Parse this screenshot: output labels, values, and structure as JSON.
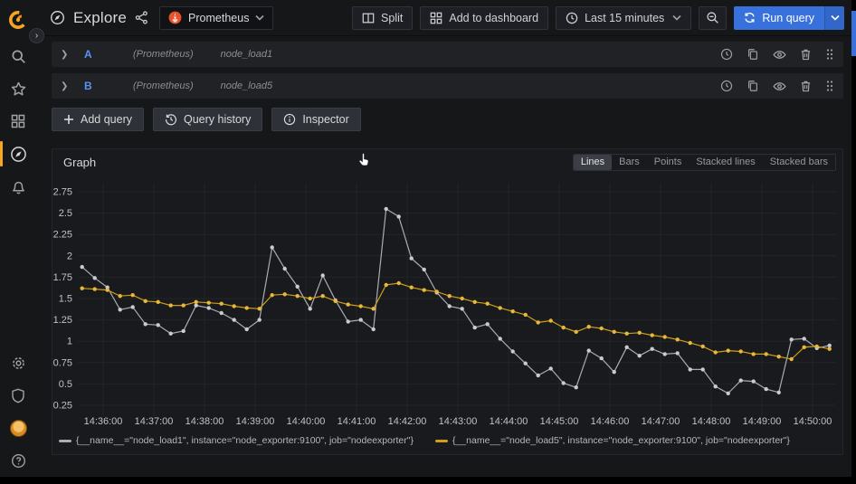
{
  "colors": {
    "accent_blue": "#3871dc",
    "grafana_orange": "#f5a623",
    "query_ref_blue": "#5794f2",
    "series_load1_line": "#a9acb2",
    "series_load1_point": "#c9cbcf",
    "series_load5_line": "#cf9f17",
    "series_load5_point": "#eab839",
    "grid": "#232428",
    "axis_text": "#c0c2c5"
  },
  "sidebar": {
    "icons": [
      {
        "name": "grafana-logo"
      },
      {
        "name": "search-icon"
      },
      {
        "name": "star-icon"
      },
      {
        "name": "dashboards-icon"
      },
      {
        "name": "explore-compass-icon",
        "active": true
      },
      {
        "name": "alerting-bell-icon"
      },
      {
        "name": "configuration-gear-icon"
      },
      {
        "name": "server-admin-shield-icon"
      },
      {
        "name": "user-avatar"
      },
      {
        "name": "help-icon"
      }
    ]
  },
  "topnav": {
    "title": "Explore",
    "datasource": {
      "name": "Prometheus"
    },
    "split_label": "Split",
    "add_to_dashboard_label": "Add to dashboard",
    "time_range_label": "Last 15 minutes",
    "run_query_label": "Run query"
  },
  "queries": {
    "rows": [
      {
        "ref": "A",
        "datasource": "(Prometheus)",
        "expr": "node_load1"
      },
      {
        "ref": "B",
        "datasource": "(Prometheus)",
        "expr": "node_load5"
      }
    ],
    "actions": {
      "add_query": "Add query",
      "query_history": "Query history",
      "inspector": "Inspector"
    }
  },
  "panel": {
    "title": "Graph",
    "modes": [
      "Lines",
      "Bars",
      "Points",
      "Stacked lines",
      "Stacked bars"
    ],
    "active_mode": "Lines"
  },
  "chart_data": {
    "type": "line",
    "title": "Graph",
    "grid": true,
    "legend_position": "bottom",
    "x_axis_range": [
      "14:35:30",
      "14:50:30"
    ],
    "x_tick_labels": [
      "14:36:00",
      "14:37:00",
      "14:38:00",
      "14:39:00",
      "14:40:00",
      "14:41:00",
      "14:42:00",
      "14:43:00",
      "14:44:00",
      "14:45:00",
      "14:46:00",
      "14:47:00",
      "14:48:00",
      "14:49:00",
      "14:50:00"
    ],
    "y_ticks": [
      0.25,
      0.5,
      0.75,
      1,
      1.25,
      1.5,
      1.75,
      2,
      2.25,
      2.5,
      2.75
    ],
    "ylim": [
      0.12,
      2.83
    ],
    "x_start": "14:35:35",
    "x_step_seconds": 15,
    "series": [
      {
        "name": "{__name__=\"node_load1\", instance=\"node_exporter:9100\", job=\"nodeexporter\"}",
        "line_color": "#a9acb2",
        "point_color": "#c9cbcf",
        "values": [
          1.87,
          1.74,
          1.63,
          1.37,
          1.4,
          1.2,
          1.19,
          1.09,
          1.12,
          1.42,
          1.39,
          1.33,
          1.25,
          1.14,
          1.25,
          2.1,
          1.85,
          1.64,
          1.38,
          1.77,
          1.48,
          1.23,
          1.25,
          1.14,
          2.55,
          2.46,
          1.97,
          1.84,
          1.57,
          1.41,
          1.38,
          1.16,
          1.2,
          1.03,
          0.88,
          0.74,
          0.6,
          0.68,
          0.51,
          0.46,
          0.89,
          0.8,
          0.64,
          0.93,
          0.83,
          0.91,
          0.85,
          0.86,
          0.67,
          0.67,
          0.47,
          0.39,
          0.54,
          0.53,
          0.44,
          0.4,
          1.02,
          1.03,
          0.92,
          0.95
        ]
      },
      {
        "name": "{__name__=\"node_load5\", instance=\"node_exporter:9100\", job=\"nodeexporter\"}",
        "line_color": "#cf9f17",
        "point_color": "#eab839",
        "values": [
          1.62,
          1.61,
          1.6,
          1.53,
          1.54,
          1.47,
          1.46,
          1.42,
          1.42,
          1.46,
          1.45,
          1.44,
          1.41,
          1.39,
          1.38,
          1.54,
          1.55,
          1.53,
          1.5,
          1.53,
          1.47,
          1.43,
          1.41,
          1.38,
          1.66,
          1.68,
          1.63,
          1.6,
          1.58,
          1.53,
          1.5,
          1.46,
          1.44,
          1.39,
          1.35,
          1.31,
          1.22,
          1.24,
          1.16,
          1.11,
          1.17,
          1.15,
          1.11,
          1.09,
          1.1,
          1.07,
          1.05,
          1.02,
          0.98,
          0.94,
          0.87,
          0.89,
          0.88,
          0.85,
          0.85,
          0.82,
          0.79,
          0.93,
          0.94,
          0.91
        ]
      }
    ]
  }
}
